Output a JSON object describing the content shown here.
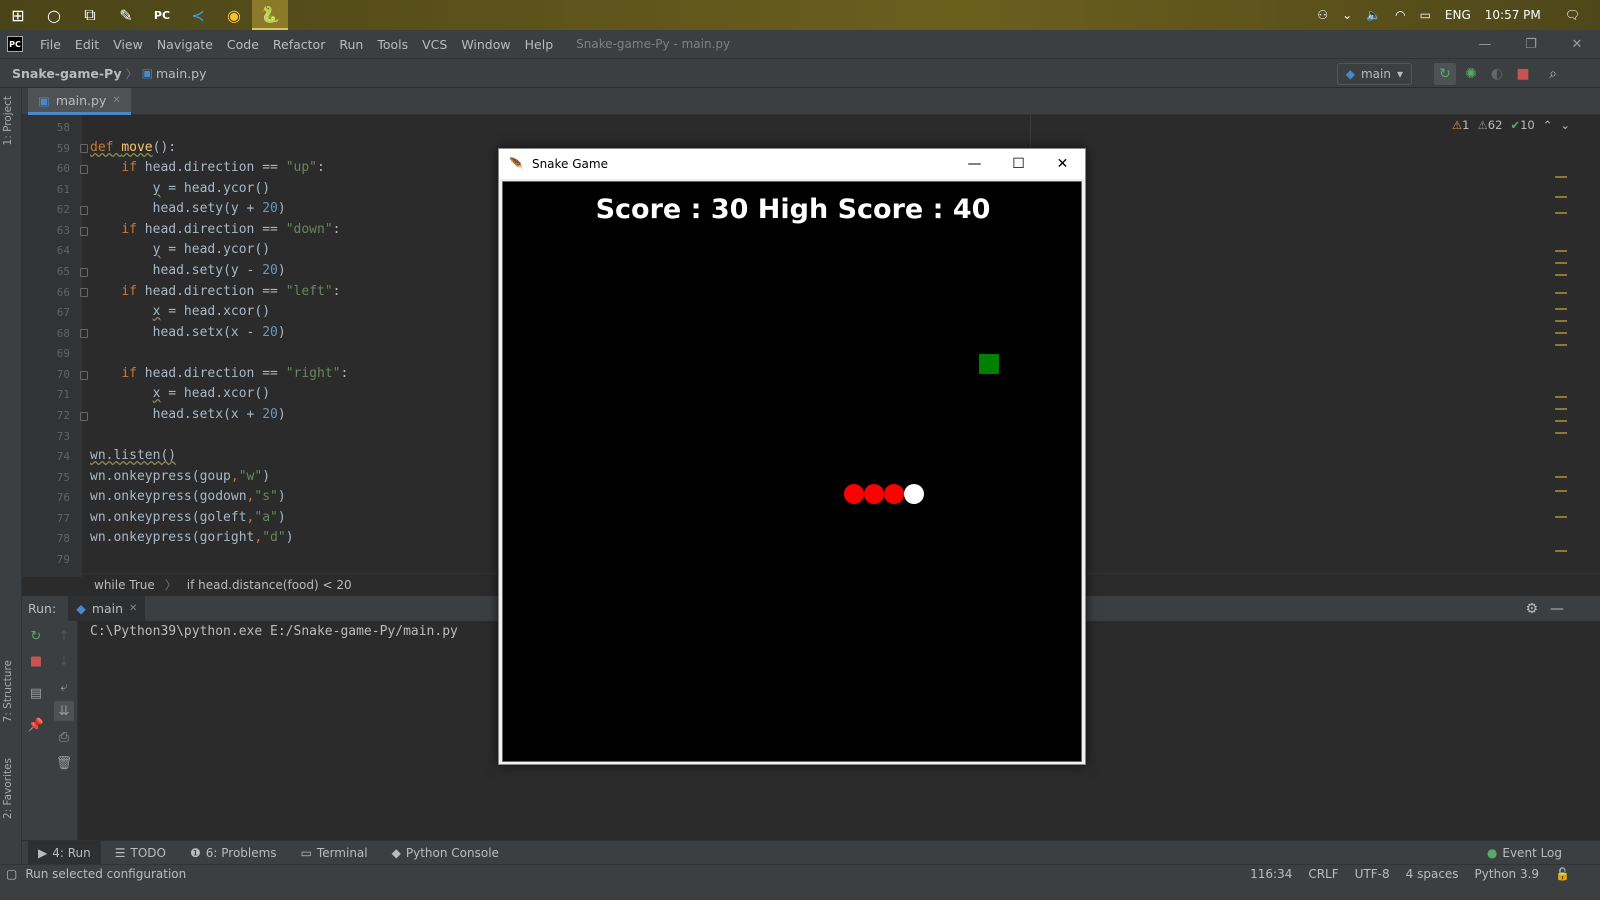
{
  "taskbar": {
    "icons": [
      "windows-start-icon",
      "search-circle-icon",
      "task-view-icon",
      "notepad-icon",
      "pycharm-icon",
      "vscode-icon",
      "chrome-icon",
      "python-turtle-icon"
    ],
    "tray": {
      "lang": "ENG",
      "time": "10:57 PM"
    }
  },
  "menubar": {
    "items": [
      "File",
      "Edit",
      "View",
      "Navigate",
      "Code",
      "Refactor",
      "Run",
      "Tools",
      "VCS",
      "Window",
      "Help"
    ],
    "window_title": "Snake-game-Py - main.py"
  },
  "navbar": {
    "project": "Snake-game-Py",
    "file": "main.py",
    "run_config": "main"
  },
  "tabs": {
    "file_tab": "main.py"
  },
  "side_tabs": {
    "project": "1: Project",
    "structure": "7: Structure",
    "favorites": "2: Favorites"
  },
  "inspections": {
    "errors": "1",
    "warnings": "62",
    "ok": "10"
  },
  "code": {
    "line_numbers": [
      "58",
      "59",
      "60",
      "61",
      "62",
      "63",
      "64",
      "65",
      "66",
      "67",
      "68",
      "69",
      "70",
      "71",
      "72",
      "73",
      "74",
      "75",
      "76",
      "77",
      "78",
      "79"
    ]
  },
  "breadcrumbs": {
    "first": "while True",
    "second": "if head.distance(food) < 20"
  },
  "run": {
    "label": "Run:",
    "tab": "main",
    "console_line": "C:\\Python39\\python.exe E:/Snake-game-Py/main.py"
  },
  "toolwindows": [
    "4: Run",
    "TODO",
    "6: Problems",
    "Terminal",
    "Python Console"
  ],
  "event_log": "Event Log",
  "status": {
    "message": "Run selected configuration",
    "position": "116:34",
    "line_sep": "CRLF",
    "encoding": "UTF-8",
    "indent": "4 spaces",
    "interpreter": "Python 3.9"
  },
  "snake_window": {
    "title": "Snake Game",
    "score_text": "Score : 30 High Score : 40",
    "colors": {
      "food": "#008000",
      "body": "#ff0000",
      "head": "#ffffff",
      "background": "#000000"
    }
  }
}
